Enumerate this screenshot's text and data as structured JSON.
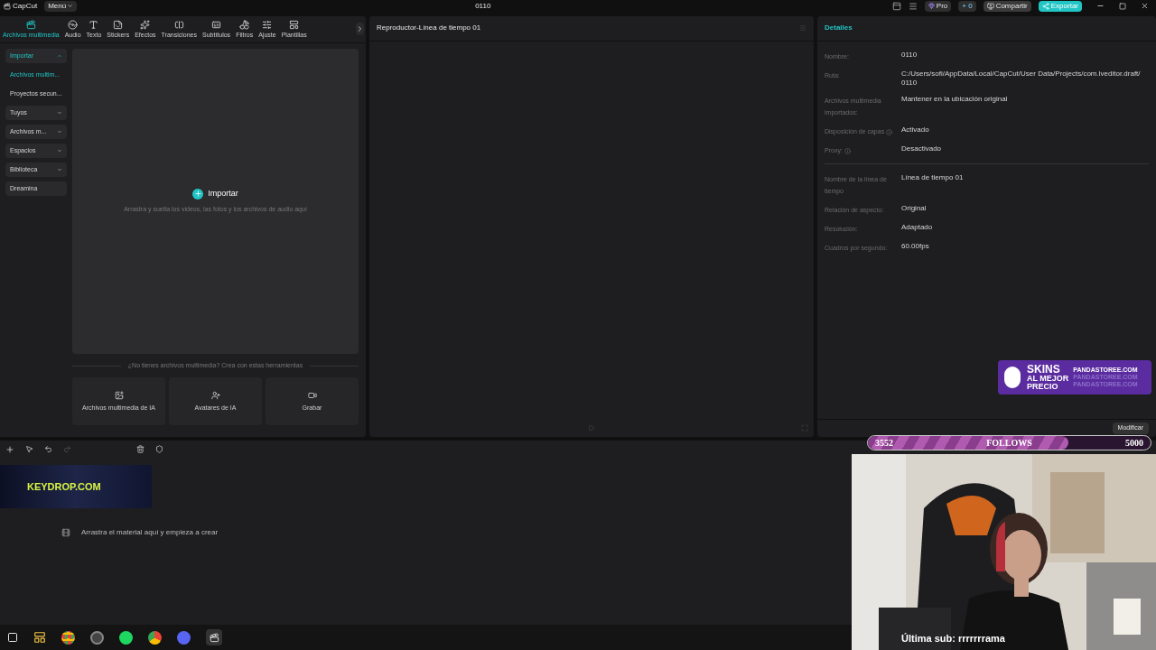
{
  "title_bar": {
    "app": "CapCut",
    "menu": "Menú",
    "project": "0110",
    "pro": "Pro",
    "credits": "+ 0",
    "share": "Compartir",
    "export": "Exportar"
  },
  "media_tabs": [
    {
      "label": "Archivos multimedia",
      "selected": true
    },
    {
      "label": "Audio",
      "selected": false
    },
    {
      "label": "Texto",
      "selected": false
    },
    {
      "label": "Stickers",
      "selected": false
    },
    {
      "label": "Efectos",
      "selected": false
    },
    {
      "label": "Transiciones",
      "selected": false
    },
    {
      "label": "Subtítulos",
      "selected": false
    },
    {
      "label": "Filtros",
      "selected": false
    },
    {
      "label": "Ajuste",
      "selected": false
    },
    {
      "label": "Plantillas",
      "selected": false
    }
  ],
  "sidebar": [
    {
      "label": "Importar",
      "kind": "group",
      "expanded": true,
      "selected": true
    },
    {
      "label": "Archivos multim...",
      "kind": "sub",
      "selected": true
    },
    {
      "label": "Proyectos secun...",
      "kind": "sub",
      "selected": false
    },
    {
      "label": "Tuyos",
      "kind": "group",
      "expanded": false,
      "selected": false
    },
    {
      "label": "Archivos m...",
      "kind": "group",
      "expanded": false,
      "selected": false
    },
    {
      "label": "Espacios",
      "kind": "group",
      "expanded": false,
      "selected": false
    },
    {
      "label": "Biblioteca",
      "kind": "group",
      "expanded": false,
      "selected": false
    },
    {
      "label": "Dreamina",
      "kind": "link",
      "selected": false
    }
  ],
  "import_area": {
    "button": "Importar",
    "hint": "Arrastra y suelta los videos, las fotos y los archivos de audio aquí"
  },
  "tools": {
    "caption": "¿No tienes archivos multimedia? Crea con estas herramientas",
    "cards": [
      "Archivos multimedia de IA",
      "Avatares de IA",
      "Grabar"
    ]
  },
  "player": {
    "title": "Reproductor-Línea de tiempo 01"
  },
  "details": {
    "title": "Detalles",
    "sections": [
      [
        {
          "label": "Nombre:",
          "value": "0110",
          "info": false
        },
        {
          "label": "Ruta:",
          "value": "C:/Users/sofi/AppData/Local/CapCut/User Data/Projects/com.lveditor.draft/ 0110",
          "info": false
        },
        {
          "label": "Archivos multimedia importados:",
          "value": "Mantener en la ubicación original",
          "info": false
        },
        {
          "label": "Disposición de capas",
          "value": "Activado",
          "info": true
        },
        {
          "label": "Proxy:",
          "value": "Desactivado",
          "info": true
        }
      ],
      [
        {
          "label": "Nombre de la línea de tiempo",
          "value": "Línea de tiempo 01",
          "info": false
        },
        {
          "label": "Relación de aspecto:",
          "value": "Original",
          "info": false
        },
        {
          "label": "Resolución:",
          "value": "Adaptado",
          "info": false
        },
        {
          "label": "Cuadros por segundo:",
          "value": "60.00fps",
          "info": false
        }
      ]
    ],
    "button": "Modificar"
  },
  "timeline": {
    "hint": "Arrastra el material aquí y empieza a crear"
  },
  "overlays": {
    "ad": {
      "headline": [
        "SKINS",
        "AL MEJOR",
        "PRECIO"
      ],
      "site_lines": [
        "PANDASTOREE.COM",
        "PANDASTOREE.COM",
        "PANDASTOREE.COM"
      ]
    },
    "banner": "KEYDROP.COM",
    "follows": {
      "current": "3552",
      "label": "FOLLOWS",
      "goal": "5000",
      "level": 0.71
    },
    "subscriber": "Última sub: rrrrrrrama"
  }
}
